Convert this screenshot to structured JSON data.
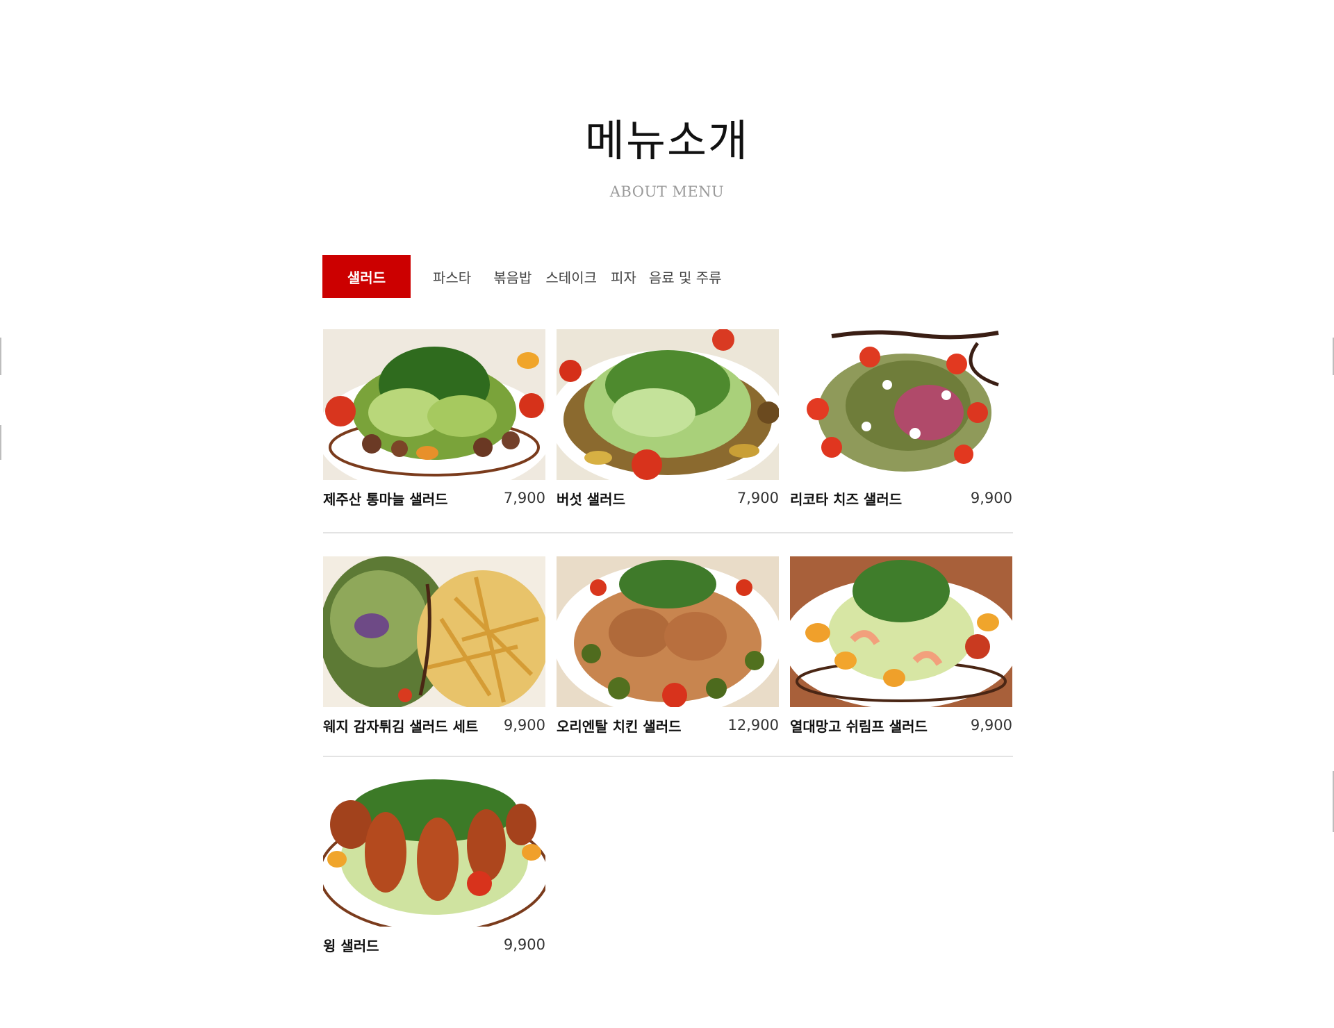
{
  "header": {
    "title": "메뉴소개",
    "subtitle": "ABOUT MENU"
  },
  "tabs": [
    {
      "label": "샐러드",
      "active": true
    },
    {
      "label": "파스타",
      "active": false
    },
    {
      "label": "볶음밥",
      "active": false
    },
    {
      "label": "스테이크",
      "active": false
    },
    {
      "label": "피자",
      "active": false
    },
    {
      "label": "음료 및 주류",
      "active": false
    }
  ],
  "colors": {
    "accent": "#cc0000",
    "divider": "#e3e3e3",
    "subtitle": "#9a9a9a"
  },
  "menu_items": [
    {
      "name": "제주산 통마늘 샐러드",
      "price": "7,900",
      "image": "garlic-salad-photo"
    },
    {
      "name": "버섯 샐러드",
      "price": "7,900",
      "image": "mushroom-salad-photo"
    },
    {
      "name": "리코타 치즈 샐러드",
      "price": "9,900",
      "image": "ricotta-salad-photo"
    },
    {
      "name": "웨지 감자튀김 샐러드 세트",
      "price": "9,900",
      "image": "wedge-fries-salad-photo"
    },
    {
      "name": "오리엔탈 치킨 샐러드",
      "price": "12,900",
      "image": "oriental-chicken-salad-photo"
    },
    {
      "name": "열대망고 쉬림프 샐러드",
      "price": "9,900",
      "image": "mango-shrimp-salad-photo"
    },
    {
      "name": "윙 샐러드",
      "price": "9,900",
      "image": "wing-salad-photo"
    }
  ]
}
